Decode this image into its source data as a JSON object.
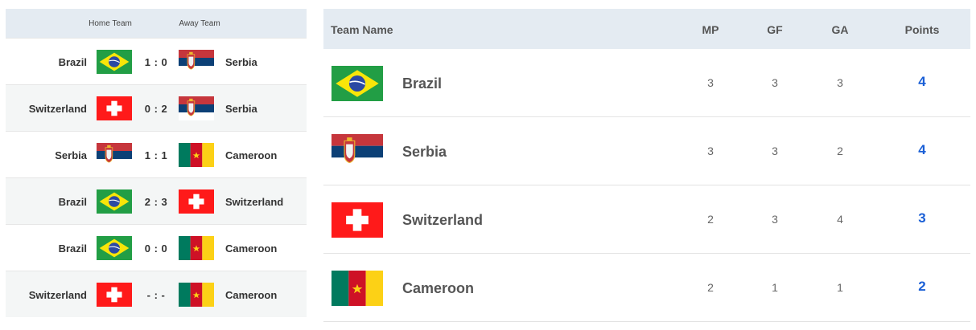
{
  "matches": {
    "header": {
      "home_label": "Home Team",
      "away_label": "Away Team"
    },
    "rows": [
      {
        "home": "Brazil",
        "home_flag": "brazil-flag",
        "score": "1 : 0",
        "away": "Serbia",
        "away_flag": "serbia-flag"
      },
      {
        "home": "Switzerland",
        "home_flag": "switzerland-flag",
        "score": "0 : 2",
        "away": "Serbia",
        "away_flag": "serbia-flag"
      },
      {
        "home": "Serbia",
        "home_flag": "serbia-flag",
        "score": "1 : 1",
        "away": "Cameroon",
        "away_flag": "cameroon-flag"
      },
      {
        "home": "Brazil",
        "home_flag": "brazil-flag",
        "score": "2 : 3",
        "away": "Switzerland",
        "away_flag": "switzerland-flag"
      },
      {
        "home": "Brazil",
        "home_flag": "brazil-flag",
        "score": "0 : 0",
        "away": "Cameroon",
        "away_flag": "cameroon-flag"
      },
      {
        "home": "Switzerland",
        "home_flag": "switzerland-flag",
        "score": "- : -",
        "away": "Cameroon",
        "away_flag": "cameroon-flag"
      }
    ]
  },
  "standings": {
    "header": {
      "team_name": "Team Name",
      "mp": "MP",
      "gf": "GF",
      "ga": "GA",
      "points": "Points"
    },
    "rows": [
      {
        "team": "Brazil",
        "flag": "brazil-flag",
        "mp": "3",
        "gf": "3",
        "ga": "3",
        "points": "4"
      },
      {
        "team": "Serbia",
        "flag": "serbia-flag",
        "mp": "3",
        "gf": "3",
        "ga": "2",
        "points": "4"
      },
      {
        "team": "Switzerland",
        "flag": "switzerland-flag",
        "mp": "2",
        "gf": "3",
        "ga": "4",
        "points": "3"
      },
      {
        "team": "Cameroon",
        "flag": "cameroon-flag",
        "mp": "2",
        "gf": "1",
        "ga": "1",
        "points": "2"
      }
    ]
  },
  "colors": {
    "header_bg": "#e4ebf2",
    "alt_row_bg": "#f4f6f6",
    "points_blue": "#1a5fd6"
  }
}
